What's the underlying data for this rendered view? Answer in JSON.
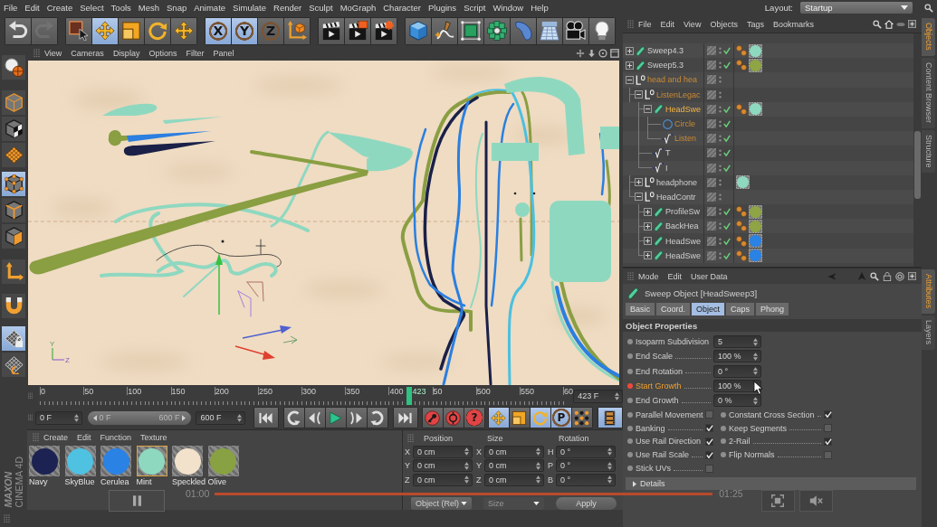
{
  "menu_bar": {
    "items": [
      "File",
      "Edit",
      "Create",
      "Select",
      "Tools",
      "Mesh",
      "Snap",
      "Animate",
      "Simulate",
      "Render",
      "Sculpt",
      "MoGraph",
      "Character",
      "Plugins",
      "Script",
      "Window",
      "Help"
    ],
    "layout_label": "Layout:",
    "layout_value": "Startup"
  },
  "toolbar": {
    "groups": [
      {
        "buttons": [
          {
            "kind": "undo",
            "selected": false,
            "disabled": false
          },
          {
            "kind": "redo",
            "selected": false,
            "disabled": true
          }
        ]
      },
      {
        "buttons": [
          {
            "kind": "select",
            "selected": false
          },
          {
            "kind": "move",
            "selected": true
          },
          {
            "kind": "scale",
            "selected": false
          },
          {
            "kind": "rotate",
            "selected": false
          },
          {
            "kind": "last_tool",
            "selected": false
          }
        ]
      },
      {
        "buttons": [
          {
            "kind": "axis",
            "label": "X",
            "selected": true
          },
          {
            "kind": "axis",
            "label": "Y",
            "selected": true
          },
          {
            "kind": "axis",
            "label": "Z",
            "selected": false
          },
          {
            "kind": "coordinates",
            "selected": false
          }
        ]
      },
      {
        "buttons": [
          {
            "kind": "render_view",
            "selected": false
          },
          {
            "kind": "render_picture",
            "selected": false
          },
          {
            "kind": "render_settings",
            "selected": false
          }
        ]
      },
      {
        "buttons": [
          {
            "kind": "cube",
            "selected": false
          },
          {
            "kind": "pen",
            "selected": false
          },
          {
            "kind": "subdivision",
            "selected": false
          },
          {
            "kind": "cloner",
            "selected": false
          },
          {
            "kind": "deformer",
            "selected": false
          },
          {
            "kind": "floor",
            "selected": false
          },
          {
            "kind": "camera",
            "selected": false
          },
          {
            "kind": "light",
            "selected": false
          }
        ]
      }
    ]
  },
  "left_toolbar": {
    "groups": [
      {
        "buttons": [
          {
            "kind": "make_editable",
            "selected": false
          }
        ]
      },
      {
        "buttons": [
          {
            "kind": "model",
            "selected": false
          },
          {
            "kind": "texture",
            "selected": false
          },
          {
            "kind": "workplane",
            "selected": false
          }
        ]
      },
      {
        "buttons": [
          {
            "kind": "points",
            "selected": true
          },
          {
            "kind": "edges",
            "selected": false
          },
          {
            "kind": "polygons",
            "selected": false
          }
        ]
      },
      {
        "buttons": [
          {
            "kind": "axis",
            "selected": false
          }
        ]
      },
      {
        "buttons": [
          {
            "kind": "snap",
            "selected": false
          }
        ]
      },
      {
        "buttons": [
          {
            "kind": "workplane_lock",
            "selected": true
          },
          {
            "kind": "workplane_rotate",
            "selected": false
          }
        ]
      }
    ]
  },
  "viewport": {
    "menu": [
      "View",
      "Cameras",
      "Display",
      "Options",
      "Filter",
      "Panel"
    ],
    "axis_labels": [
      "Y",
      "Z"
    ]
  },
  "timeline": {
    "frame_labels": [
      "0",
      "50",
      "100",
      "150",
      "200",
      "250",
      "300",
      "350",
      "400",
      "50",
      "500",
      "550",
      "60"
    ],
    "playhead": {
      "label": "423",
      "level": 0.705
    },
    "frame_field": "423 F"
  },
  "transport": {
    "start_field": "0 F",
    "range": {
      "start": "0 F",
      "end": "600 F"
    },
    "end_field": "600 F",
    "groups": [
      {
        "buttons": [
          {
            "kind": "go_start",
            "selected": false
          }
        ]
      },
      {
        "buttons": [
          {
            "kind": "prev_key",
            "selected": false
          },
          {
            "kind": "step_back",
            "selected": false
          },
          {
            "kind": "play",
            "selected": false
          },
          {
            "kind": "step_forward",
            "selected": false
          },
          {
            "kind": "next_key",
            "selected": false
          }
        ]
      },
      {
        "buttons": [
          {
            "kind": "go_end",
            "selected": false
          }
        ]
      },
      {
        "buttons": [
          {
            "kind": "record",
            "selected": false
          },
          {
            "kind": "autokey",
            "selected": false
          },
          {
            "kind": "key_selection",
            "label": "?",
            "selected": false
          }
        ]
      },
      {
        "buttons": [
          {
            "kind": "move",
            "selected": true
          },
          {
            "kind": "scale",
            "selected": false
          },
          {
            "kind": "rotate",
            "selected": true
          },
          {
            "kind": "parameter",
            "label": "P",
            "selected": true
          },
          {
            "kind": "points",
            "selected": false
          }
        ]
      },
      {
        "buttons": [
          {
            "kind": "timeline",
            "selected": true
          }
        ]
      }
    ]
  },
  "logo": {
    "brand": "MAXON",
    "product": "CINEMA 4D"
  },
  "material_manager": {
    "menu": [
      "Create",
      "Edit",
      "Function",
      "Texture"
    ],
    "materials": [
      {
        "name": "Navy",
        "color": "#1c2352",
        "selected": false
      },
      {
        "name": "SkyBlue",
        "color": "#4fc2e2",
        "selected": false
      },
      {
        "name": "Cerulea",
        "color": "#2a82e4",
        "selected": false
      },
      {
        "name": "Mint",
        "color": "#8ed8bf",
        "selected": true
      },
      {
        "name": "Speckled",
        "color": "#f3e2cb",
        "selected": false
      },
      {
        "name": "Olive",
        "color": "#88a142",
        "selected": false
      }
    ]
  },
  "coordinates": {
    "headers": [
      "Position",
      "Size",
      "Rotation"
    ],
    "rows": [
      {
        "cells": [
          {
            "axis": "X",
            "value": "0 cm"
          },
          {
            "axis": "X",
            "value": "0 cm"
          },
          {
            "axis": "H",
            "value": "0 °"
          }
        ]
      },
      {
        "cells": [
          {
            "axis": "Y",
            "value": "0 cm"
          },
          {
            "axis": "Y",
            "value": "0 cm"
          },
          {
            "axis": "P",
            "value": "0 °"
          }
        ]
      },
      {
        "cells": [
          {
            "axis": "Z",
            "value": "0 cm"
          },
          {
            "axis": "Z",
            "value": "0 cm"
          },
          {
            "axis": "B",
            "value": "0 °"
          }
        ]
      }
    ],
    "mode": {
      "value": "Object (Rel)",
      "disabled": false
    },
    "size_mode": {
      "value": "Size",
      "disabled": true
    },
    "apply": "Apply"
  },
  "object_manager": {
    "menu": [
      "File",
      "Edit",
      "View",
      "Objects",
      "Tags",
      "Bookmarks"
    ],
    "objects": [
      {
        "name": "Sweep4.3",
        "kind": "sweep",
        "expanded": false,
        "selected": false,
        "current": false,
        "enabled": true,
        "tags": [
          {
            "kind": "phong"
          },
          {
            "kind": "material",
            "color": "#8ed8bf"
          }
        ]
      },
      {
        "name": "Sweep5.3",
        "kind": "sweep",
        "expanded": false,
        "selected": false,
        "current": false,
        "enabled": true,
        "tags": [
          {
            "kind": "phong"
          },
          {
            "kind": "material",
            "color": "#8fa444"
          }
        ]
      },
      {
        "name": "head and hea",
        "kind": "null",
        "expanded": true,
        "selected": true,
        "current": false,
        "children": [
          {
            "name": "ListenLegac",
            "kind": "null",
            "expanded": true,
            "selected": true,
            "current": false,
            "children": [
              {
                "name": "HeadSwe",
                "kind": "sweep",
                "expanded": true,
                "selected": true,
                "current": true,
                "enabled": true,
                "tags": [
                  {
                    "kind": "phong"
                  },
                  {
                    "kind": "material",
                    "color": "#8ed8bf"
                  }
                ],
                "children": [
                  {
                    "name": "Circle",
                    "kind": "circle",
                    "selected": true,
                    "current": false,
                    "enabled": true
                  },
                  {
                    "name": "Listen",
                    "kind": "spline",
                    "selected": true,
                    "current": false,
                    "enabled": true
                  }
                ]
              },
              {
                "name": "T",
                "kind": "spline",
                "selected": false,
                "current": false,
                "enabled": true
              },
              {
                "name": "I",
                "kind": "spline",
                "selected": false,
                "current": false,
                "enabled": true
              }
            ]
          },
          {
            "name": "headphone",
            "kind": "null",
            "expanded": false,
            "selected": false,
            "current": false,
            "tags": [
              {
                "kind": "material",
                "color": "#8ed8bf"
              }
            ]
          },
          {
            "name": "HeadContr",
            "kind": "null",
            "expanded": true,
            "selected": false,
            "current": false,
            "children": [
              {
                "name": "ProfileSw",
                "kind": "sweep",
                "expanded": false,
                "selected": false,
                "current": false,
                "enabled": true,
                "tags": [
                  {
                    "kind": "phong"
                  },
                  {
                    "kind": "material",
                    "color": "#8fa444"
                  }
                ]
              },
              {
                "name": "BackHea",
                "kind": "sweep",
                "expanded": false,
                "selected": false,
                "current": false,
                "enabled": true,
                "tags": [
                  {
                    "kind": "phong"
                  },
                  {
                    "kind": "material",
                    "color": "#8fa444"
                  }
                ]
              },
              {
                "name": "HeadSwe",
                "kind": "sweep",
                "expanded": false,
                "selected": false,
                "current": false,
                "enabled": true,
                "tags": [
                  {
                    "kind": "phong"
                  },
                  {
                    "kind": "material",
                    "color": "#2a82e4"
                  }
                ]
              },
              {
                "name": "HeadSwe",
                "kind": "sweep",
                "expanded": false,
                "selected": false,
                "current": false,
                "enabled": true,
                "tags": [
                  {
                    "kind": "phong"
                  },
                  {
                    "kind": "material",
                    "color": "#2a82e4"
                  }
                ]
              }
            ]
          }
        ]
      }
    ]
  },
  "object_tabs": [
    {
      "label": "Objects",
      "selected": true
    },
    {
      "label": "Content Browser",
      "selected": false
    },
    {
      "label": "Structure",
      "selected": false
    }
  ],
  "attributes": {
    "menu": [
      "Mode",
      "Edit",
      "User Data"
    ],
    "title": "Sweep Object [HeadSweep3]",
    "tabs": [
      {
        "label": "Basic",
        "selected": false
      },
      {
        "label": "Coord.",
        "selected": false
      },
      {
        "label": "Object",
        "selected": true
      },
      {
        "label": "Caps",
        "selected": false
      },
      {
        "label": "Phong",
        "selected": false
      }
    ],
    "section": "Object Properties",
    "properties": [
      {
        "label": "Isoparm Subdivision",
        "value": "5",
        "animated": false
      },
      {
        "label": "End Scale",
        "value": "100 %",
        "animated": false
      },
      {
        "label": "End Rotation",
        "value": "0 °",
        "animated": false
      },
      {
        "label": "Start Growth",
        "value": "100 %",
        "animated": true
      },
      {
        "label": "End Growth",
        "value": "0 %",
        "animated": false
      }
    ],
    "options": [
      {
        "label": "Parallel Movement",
        "checked": false
      },
      {
        "label": "Constant Cross Section",
        "checked": true
      },
      {
        "label": "Banking",
        "checked": true
      },
      {
        "label": "Keep Segments",
        "checked": false
      },
      {
        "label": "Use Rail Direction",
        "checked": true
      },
      {
        "label": "2-Rail",
        "checked": true
      },
      {
        "label": "Use Rail Scale",
        "checked": true
      },
      {
        "label": "Flip Normals",
        "checked": false
      },
      {
        "label": "Stick UVs",
        "checked": false
      }
    ],
    "details": "Details"
  },
  "attribute_tabs": [
    {
      "label": "Attributes",
      "selected": true
    },
    {
      "label": "Layers",
      "selected": false
    }
  ],
  "video_player": {
    "playing": true,
    "elapsed": "01:00",
    "duration": "01:25"
  }
}
